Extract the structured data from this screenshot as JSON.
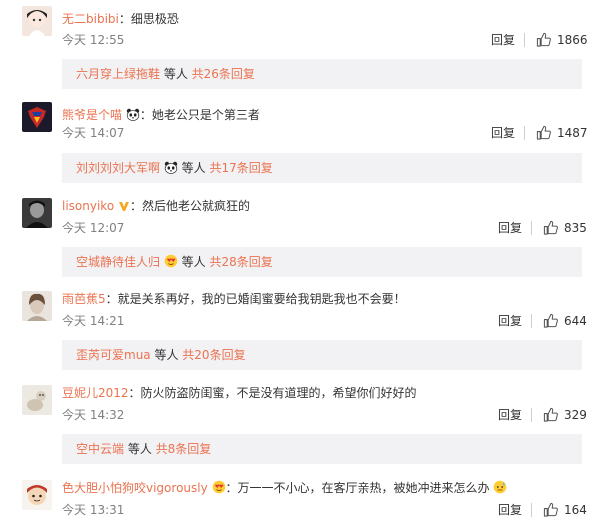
{
  "comments": [
    {
      "username": "无二bibibi",
      "text": "：细思极恐",
      "time": "今天 12:55",
      "reply_label": "回复",
      "likes": "1866",
      "sub": {
        "name": "六月穿上绿拖鞋",
        "etc": " 等人",
        "more": " 共26条回复"
      }
    },
    {
      "username": "熊爷是个喵",
      "text": "：她老公只是个第三者",
      "time": "今天 14:07",
      "reply_label": "回复",
      "likes": "1487",
      "sub": {
        "name": "刘刘刘刘大军啊",
        "etc": " 等人",
        "more": " 共17条回复"
      }
    },
    {
      "username": "lisonyiko",
      "text": "：然后他老公就疯狂的",
      "time": "今天 12:07",
      "reply_label": "回复",
      "likes": "835",
      "sub": {
        "name": "空城静待佳人归",
        "etc": " 等人",
        "more": " 共28条回复"
      }
    },
    {
      "username": "雨芭蕉5",
      "text": "：就是关系再好，我的已婚闺蜜要给我钥匙我也不会要！",
      "time": "今天 14:21",
      "reply_label": "回复",
      "likes": "644",
      "sub": {
        "name": "歪芮可爱mua",
        "etc": " 等人",
        "more": " 共20条回复"
      }
    },
    {
      "username": "豆妮儿2012",
      "text": "：防火防盗防闺蜜，不是没有道理的，希望你们好好的",
      "time": "今天 14:32",
      "reply_label": "回复",
      "likes": "329",
      "sub": {
        "name": "空中云端",
        "etc": " 等人",
        "more": " 共8条回复"
      }
    },
    {
      "username": "色大胆小怕狗咬vigorously",
      "text": "：万一一不小心，在客厅亲热，被她冲进来怎么办",
      "time": "今天 13:31",
      "reply_label": "回复",
      "likes": "164"
    }
  ],
  "colors": {
    "username": "#eb7350",
    "subbox_bg": "#f2f2f5",
    "time": "#808080"
  },
  "icons": {
    "like": "thumbs-up-icon",
    "panda": "panda-emoji-icon",
    "vip": "vip-badge-icon",
    "heart_face": "heart-eyes-emoji-icon",
    "sweat": "sweat-emoji-icon"
  }
}
